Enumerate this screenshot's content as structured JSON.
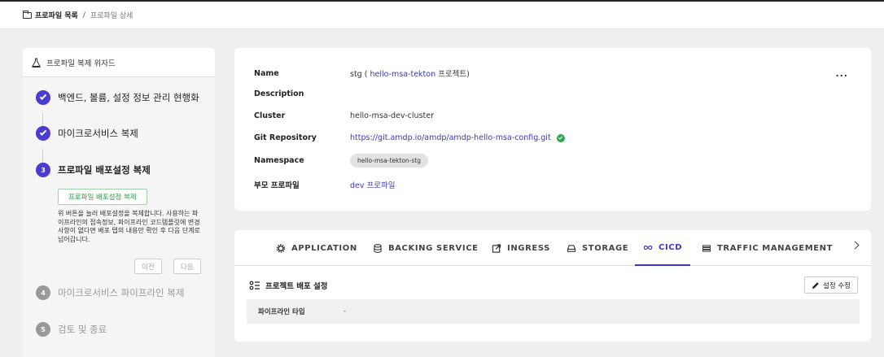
{
  "breadcrumb": {
    "home": "프로파일 목록",
    "separator": "/",
    "current": "프로파일 상세"
  },
  "wizard": {
    "title": "프로파일 복제 위자드",
    "steps": [
      {
        "label": "백엔드, 볼륨, 설정 정보 관리 현행화",
        "status": "done",
        "number": ""
      },
      {
        "label": "마이크로서비스 복제",
        "status": "done",
        "number": ""
      },
      {
        "label": "프로파일 배포설정 복제",
        "status": "active",
        "number": "3"
      },
      {
        "label": "마이크로서비스 파이프라인 복제",
        "status": "todo",
        "number": "4"
      },
      {
        "label": "검토 및 종료",
        "status": "todo",
        "number": "5"
      }
    ],
    "copy_button": "프로파일 배포설정 복제",
    "help_text": "위 버튼을 눌러 배포설정을 복제합니다. 사용하는 파이프라인의 접속정보, 파이프라인 코드템플릿에 변경사항이 없다면 배포 탭의 내용만 확인 후 다음 단계로 넘어갑니다.",
    "prev_button": "이전",
    "next_button": "다음"
  },
  "profile": {
    "name_label": "Name",
    "name_value": "stg (",
    "name_project_link": "hello-msa-tekton",
    "name_suffix": "프로젝트)",
    "description_label": "Description",
    "description_value": "",
    "cluster_label": "Cluster",
    "cluster_value": "hello-msa-dev-cluster",
    "git_label": "Git Repository",
    "git_value": "https://git.amdp.io/amdp/amdp-hello-msa-config.git",
    "namespace_label": "Namespace",
    "namespace_value": "hello-msa-tekton-stg",
    "parent_label": "부모 프로파일",
    "parent_value": "dev 프로파일",
    "more": "..."
  },
  "tabs": [
    {
      "label": "APPLICATION",
      "icon": "gear-icon",
      "active": false
    },
    {
      "label": "BACKING SERVICE",
      "icon": "database-icon",
      "active": false
    },
    {
      "label": "INGRESS",
      "icon": "external-link-icon",
      "active": false
    },
    {
      "label": "STORAGE",
      "icon": "drive-icon",
      "active": false
    },
    {
      "label": "CICD",
      "icon": "infinity-icon",
      "active": true
    },
    {
      "label": "TRAFFIC MANAGEMENT",
      "icon": "traffic-icon",
      "active": false
    }
  ],
  "cicd": {
    "section_title": "프로젝트 배포 설정",
    "edit_button": "설정 수정",
    "pipeline_label": "파이프라인 타입",
    "pipeline_value": "-"
  },
  "colors": {
    "accent": "#3a36c6",
    "success": "#2ea84d"
  }
}
